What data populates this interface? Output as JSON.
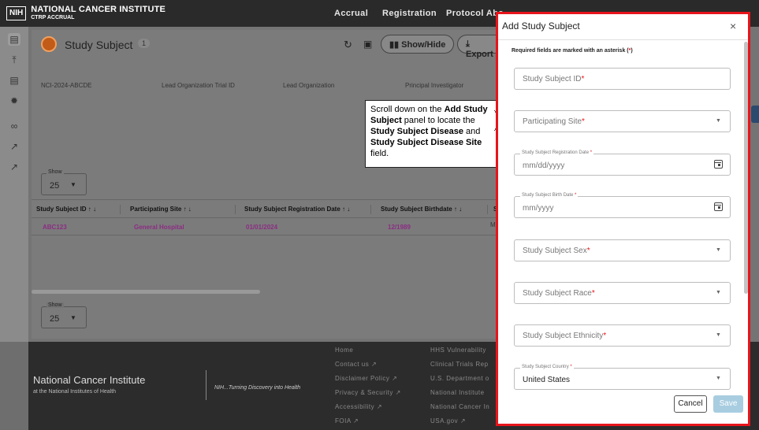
{
  "header": {
    "logo_box": "NIH",
    "logo_title": "NATIONAL CANCER INSTITUTE",
    "logo_sub": "CTRP ACCRUAL",
    "nav": [
      "Accrual",
      "Registration",
      "Protocol Abs"
    ]
  },
  "toolbar": {
    "title": "Study Subject",
    "count": "1",
    "show_hide": "Show/Hide",
    "export": "Export"
  },
  "trial_info": {
    "trial_id": "NCI-2024-ABCDE",
    "lead_org_trial_id_label": "Lead Organization Trial ID",
    "lead_org_label": "Lead Organization",
    "pi_label": "Principal Investigator"
  },
  "pager_top": {
    "label": "Show",
    "value": "25"
  },
  "pager_bottom": {
    "label": "Show",
    "value": "25"
  },
  "table": {
    "columns": [
      "Study Subject ID",
      "Participating Site",
      "Study Subject Registration Date",
      "Study Subject Birthdate",
      "S"
    ],
    "rows": [
      {
        "id": "ABC123",
        "site": "General Hospital",
        "reg_date": "01/01/2024",
        "birthdate": "12/1989",
        "extra": "M"
      }
    ]
  },
  "callout": {
    "t1": "Scroll down on the ",
    "b1": "Add Study Subject",
    "t2": " panel to locate the ",
    "b2": "Study Subject Disease",
    "t3": " and ",
    "b3": "Study Subject Disease Site",
    "t4": " field."
  },
  "footer": {
    "title": "National Cancer Institute",
    "subtitle": "at the National Institutes of Health",
    "tagline": "NIH...Turning Discovery into Health",
    "links_col1": [
      "Home",
      "Contact us",
      "Disclaimer Policy",
      "Privacy & Security",
      "Accessibility",
      "FOIA"
    ],
    "links_col2": [
      "HHS Vulnerability",
      "Clinical Trials Rep",
      "U.S. Department o",
      "National Institute",
      "National Cancer In",
      "USA.gov"
    ]
  },
  "modal": {
    "title": "Add Study Subject",
    "close": "×",
    "required_note": "Required fields are marked with an asterisk (",
    "required_note_end": ")",
    "asterisk": "*",
    "fields": {
      "subject_id": "Study Subject ID",
      "site": "Participating Site",
      "reg_date_label": "Study Subject Registration Date",
      "reg_date_ph": "mm/dd/yyyy",
      "birth_label": "Study Subject Birth Date",
      "birth_ph": "mm/yyyy",
      "sex": "Study Subject Sex",
      "race": "Study Subject Race",
      "ethnicity": "Study Subject Ethnicity",
      "country_label": "Study Subject Country",
      "country_value": "United States"
    },
    "cancel": "Cancel",
    "save": "Save"
  },
  "colors": {
    "highlight_border": "#e8141b",
    "accent_purple": "#8c2d84",
    "save_disabled": "#a8cde0"
  }
}
